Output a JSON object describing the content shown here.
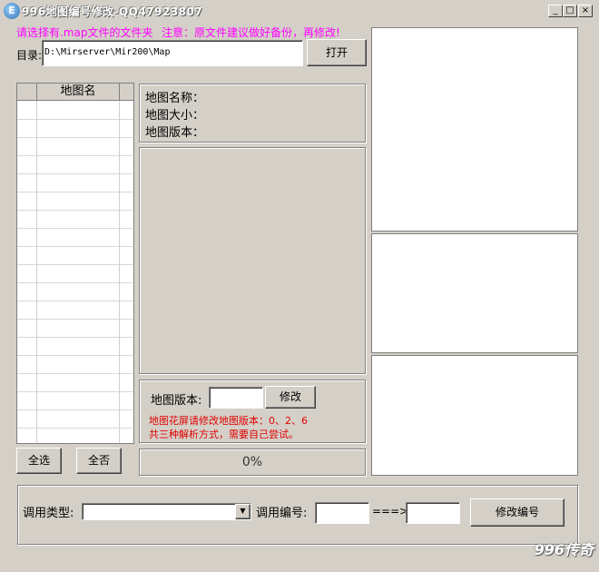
{
  "window": {
    "title": "996地图编号修改-QQ47923807",
    "icon_letter": "E",
    "min_glyph": "_",
    "max_glyph": "□",
    "close_glyph": "×"
  },
  "hint": {
    "select_folder": "请选择有.map文件的文件夹",
    "note": "注意：原文件建议做好备份，再修改!"
  },
  "directory": {
    "label": "目录:",
    "value": "D:\\Mirserver\\Mir200\\Map",
    "open_button": "打开"
  },
  "map_list": {
    "header": "地图名",
    "rows": 19
  },
  "map_info": {
    "name_label": "地图名称：",
    "size_label": "地图大小：",
    "version_label": "地图版本："
  },
  "version_edit": {
    "label": "地图版本:",
    "value": "",
    "modify_button": "修改",
    "tip_line1": "地图花屏请修改地图版本：0、2、6",
    "tip_line2": "共三种解析方式，需要自己尝试。"
  },
  "selection": {
    "select_all": "全选",
    "select_none": "全否"
  },
  "progress": {
    "value": 0,
    "text": "0%"
  },
  "bottom": {
    "call_type_label": "调用类型:",
    "call_type_value": "",
    "call_number_label": "调用编号:",
    "from_value": "",
    "arrow": "===>",
    "to_value": "",
    "modify_number_button": "修改编号"
  },
  "watermark": "996传奇"
}
